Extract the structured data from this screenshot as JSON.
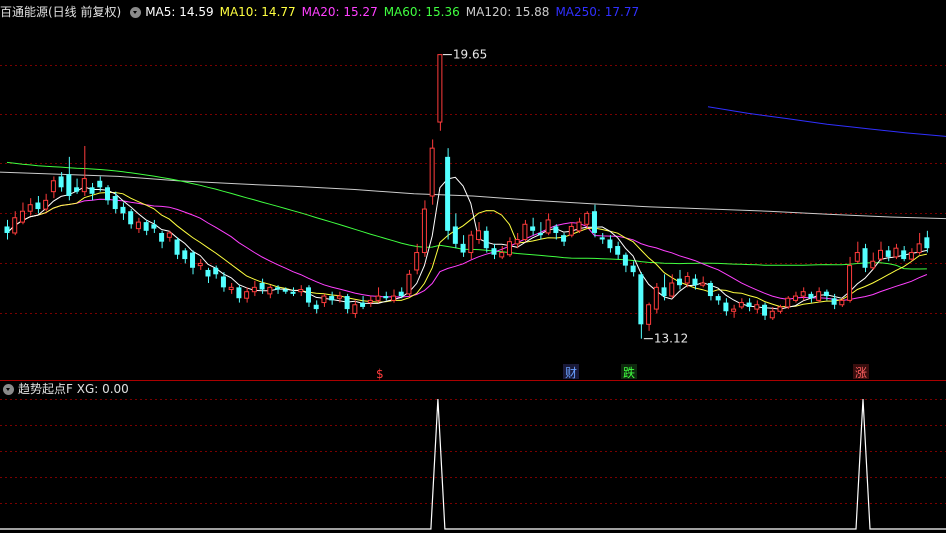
{
  "main_header": {
    "title": "百通能源(日线 前复权)",
    "ma": [
      {
        "label": "MA5: 14.59",
        "color": "#ffffff"
      },
      {
        "label": "MA10: 14.77",
        "color": "#ffff40"
      },
      {
        "label": "MA20: 15.27",
        "color": "#ff40ff"
      },
      {
        "label": "MA60: 15.36",
        "color": "#40ff40"
      },
      {
        "label": "MA120: 15.88",
        "color": "#cccccc"
      },
      {
        "label": "MA250: 17.77",
        "color": "#3030ff"
      }
    ]
  },
  "indicator_header": {
    "label": "趋势起点F  XG: 0.00"
  },
  "colors": {
    "up": "#ff3c3c",
    "down": "#54ffff",
    "grid": "#7a0000",
    "border": "#aa0000",
    "ma5": "#ffffff",
    "ma10": "#ffff40",
    "ma20": "#ff40ff",
    "ma60": "#40ff40",
    "ma120": "#cccccc",
    "ma250": "#3030ff",
    "xg": "#ffffff"
  },
  "chart_data": [
    {
      "type": "candlestick",
      "price_range": [
        12.4,
        20.4
      ],
      "max_label": "19.65",
      "min_label": "13.12",
      "candles": [
        [
          15.7,
          15.55,
          15.85,
          15.4
        ],
        [
          15.55,
          15.9,
          16.05,
          15.5
        ],
        [
          15.8,
          16.05,
          16.25,
          15.75
        ],
        [
          16.05,
          16.2,
          16.35,
          15.95
        ],
        [
          16.25,
          16.1,
          16.4,
          16.0
        ],
        [
          16.1,
          16.3,
          16.45,
          16.05
        ],
        [
          16.5,
          16.75,
          16.85,
          16.35
        ],
        [
          16.85,
          16.6,
          16.95,
          16.5
        ],
        [
          16.9,
          16.4,
          17.3,
          16.3
        ],
        [
          16.6,
          16.5,
          16.8,
          16.45
        ],
        [
          16.5,
          16.8,
          17.55,
          16.4
        ],
        [
          16.6,
          16.45,
          16.7,
          16.3
        ],
        [
          16.75,
          16.6,
          16.85,
          16.5
        ],
        [
          16.6,
          16.3,
          16.65,
          16.2
        ],
        [
          16.4,
          16.1,
          16.5,
          16.0
        ],
        [
          16.15,
          16.0,
          16.25,
          15.85
        ],
        [
          16.05,
          15.75,
          16.1,
          15.65
        ],
        [
          15.65,
          15.8,
          15.9,
          15.55
        ],
        [
          15.8,
          15.6,
          15.85,
          15.5
        ],
        [
          15.75,
          15.65,
          15.85,
          15.55
        ],
        [
          15.55,
          15.35,
          15.6,
          15.2
        ],
        [
          15.45,
          15.55,
          15.6,
          15.35
        ],
        [
          15.4,
          15.05,
          15.45,
          14.95
        ],
        [
          15.15,
          14.95,
          15.2,
          14.85
        ],
        [
          15.1,
          14.75,
          15.15,
          14.6
        ],
        [
          14.8,
          14.85,
          14.95,
          14.7
        ],
        [
          14.7,
          14.55,
          14.75,
          14.4
        ],
        [
          14.75,
          14.6,
          14.8,
          14.5
        ],
        [
          14.55,
          14.3,
          14.65,
          14.2
        ],
        [
          14.25,
          14.3,
          14.4,
          14.15
        ],
        [
          14.3,
          14.05,
          14.35,
          13.95
        ],
        [
          14.05,
          14.2,
          14.3,
          13.95
        ],
        [
          14.2,
          14.3,
          14.45,
          14.1
        ],
        [
          14.4,
          14.25,
          14.5,
          14.15
        ],
        [
          14.15,
          14.3,
          14.35,
          14.05
        ],
        [
          14.3,
          14.25,
          14.35,
          14.15
        ],
        [
          14.25,
          14.2,
          14.3,
          14.15
        ],
        [
          14.2,
          14.15,
          14.3,
          14.1
        ],
        [
          14.2,
          14.25,
          14.35,
          14.1
        ],
        [
          14.3,
          13.95,
          14.35,
          13.85
        ],
        [
          13.9,
          13.8,
          14.0,
          13.7
        ],
        [
          13.95,
          14.1,
          14.15,
          13.85
        ],
        [
          14.1,
          14.0,
          14.2,
          13.9
        ],
        [
          14.05,
          14.1,
          14.2,
          13.95
        ],
        [
          14.1,
          13.8,
          14.15,
          13.7
        ],
        [
          13.7,
          13.9,
          14.0,
          13.6
        ],
        [
          13.95,
          13.85,
          14.1,
          13.8
        ],
        [
          13.95,
          14.0,
          14.1,
          13.85
        ],
        [
          14.0,
          14.1,
          14.3,
          13.95
        ],
        [
          14.1,
          14.05,
          14.2,
          14.0
        ],
        [
          14.0,
          14.1,
          14.25,
          13.95
        ],
        [
          14.2,
          14.1,
          14.3,
          14.05
        ],
        [
          14.15,
          14.6,
          14.7,
          14.1
        ],
        [
          14.7,
          15.1,
          15.3,
          14.6
        ],
        [
          15.1,
          16.1,
          16.3,
          15.0
        ],
        [
          16.4,
          17.5,
          17.7,
          16.2
        ],
        [
          18.1,
          19.65,
          19.65,
          17.9
        ],
        [
          17.3,
          15.6,
          17.5,
          15.4
        ],
        [
          15.7,
          15.3,
          16.0,
          15.2
        ],
        [
          15.3,
          15.1,
          15.5,
          15.0
        ],
        [
          15.1,
          15.5,
          15.6,
          14.95
        ],
        [
          15.4,
          15.6,
          15.8,
          15.3
        ],
        [
          15.6,
          15.2,
          15.7,
          15.1
        ],
        [
          15.2,
          15.05,
          15.3,
          14.95
        ],
        [
          15.0,
          15.1,
          15.25,
          14.95
        ],
        [
          15.05,
          15.35,
          15.45,
          15.0
        ],
        [
          15.3,
          15.4,
          15.55,
          15.2
        ],
        [
          15.4,
          15.75,
          15.85,
          15.35
        ],
        [
          15.7,
          15.6,
          15.9,
          15.5
        ],
        [
          15.55,
          15.5,
          15.8,
          15.4
        ],
        [
          15.55,
          15.85,
          16.0,
          15.5
        ],
        [
          15.7,
          15.55,
          15.75,
          15.4
        ],
        [
          15.5,
          15.35,
          15.55,
          15.25
        ],
        [
          15.5,
          15.7,
          15.8,
          15.45
        ],
        [
          15.6,
          15.8,
          15.9,
          15.55
        ],
        [
          15.75,
          16.0,
          16.05,
          15.65
        ],
        [
          16.05,
          15.55,
          16.2,
          15.45
        ],
        [
          15.45,
          15.4,
          15.55,
          15.3
        ],
        [
          15.4,
          15.2,
          15.5,
          15.1
        ],
        [
          15.25,
          15.05,
          15.35,
          14.95
        ],
        [
          15.05,
          14.8,
          15.1,
          14.65
        ],
        [
          14.8,
          14.65,
          14.9,
          14.55
        ],
        [
          14.6,
          13.45,
          14.65,
          13.12
        ],
        [
          13.45,
          13.9,
          13.95,
          13.3
        ],
        [
          13.8,
          14.3,
          14.4,
          13.7
        ],
        [
          14.3,
          14.1,
          14.6,
          14.0
        ],
        [
          14.1,
          14.4,
          14.6,
          14.05
        ],
        [
          14.5,
          14.35,
          14.7,
          14.25
        ],
        [
          14.4,
          14.55,
          14.65,
          14.3
        ],
        [
          14.5,
          14.35,
          14.6,
          14.25
        ],
        [
          14.35,
          14.4,
          14.55,
          14.3
        ],
        [
          14.4,
          14.1,
          14.45,
          14.0
        ],
        [
          14.1,
          14.0,
          14.15,
          13.9
        ],
        [
          13.95,
          13.75,
          14.05,
          13.65
        ],
        [
          13.75,
          13.8,
          13.9,
          13.6
        ],
        [
          13.85,
          13.95,
          14.05,
          13.8
        ],
        [
          13.95,
          13.85,
          14.05,
          13.75
        ],
        [
          13.8,
          13.9,
          14.0,
          13.7
        ],
        [
          13.9,
          13.65,
          13.95,
          13.55
        ],
        [
          13.6,
          13.75,
          13.85,
          13.55
        ],
        [
          13.75,
          13.85,
          13.9,
          13.7
        ],
        [
          13.85,
          14.05,
          14.1,
          13.8
        ],
        [
          14.0,
          14.1,
          14.2,
          13.95
        ],
        [
          14.1,
          14.2,
          14.3,
          14.0
        ],
        [
          14.15,
          14.05,
          14.2,
          13.95
        ],
        [
          14.0,
          14.2,
          14.3,
          13.95
        ],
        [
          14.2,
          14.1,
          14.25,
          14.0
        ],
        [
          14.05,
          13.9,
          14.15,
          13.8
        ],
        [
          13.9,
          14.0,
          14.05,
          13.85
        ],
        [
          14.0,
          14.8,
          15.0,
          13.95
        ],
        [
          14.9,
          15.1,
          15.35,
          14.85
        ],
        [
          15.2,
          14.75,
          15.3,
          14.65
        ],
        [
          14.75,
          14.9,
          15.1,
          14.7
        ],
        [
          14.95,
          15.15,
          15.35,
          14.9
        ],
        [
          15.15,
          15.0,
          15.25,
          14.9
        ],
        [
          15.0,
          15.2,
          15.3,
          14.95
        ],
        [
          15.15,
          14.95,
          15.25,
          14.9
        ],
        [
          14.95,
          15.1,
          15.2,
          14.9
        ],
        [
          15.1,
          15.3,
          15.55,
          15.05
        ],
        [
          15.45,
          15.2,
          15.6,
          15.1
        ]
      ],
      "ma120": [
        16.95,
        16.9,
        16.85,
        16.75,
        16.68,
        16.62,
        16.55,
        16.45,
        16.4,
        16.3,
        16.22,
        16.15,
        16.1,
        16.05,
        15.98,
        15.92,
        15.88
      ],
      "ma250": [
        18.45,
        18.3,
        18.18,
        18.05,
        17.95,
        17.85,
        17.77
      ]
    },
    {
      "type": "line",
      "series": [
        {
          "name": "XG",
          "signals": [
            56,
            111
          ]
        }
      ],
      "ylim": [
        0,
        1
      ]
    }
  ],
  "markers": {
    "s": "$",
    "cai": "财",
    "die": "跌",
    "zhang": "涨"
  }
}
